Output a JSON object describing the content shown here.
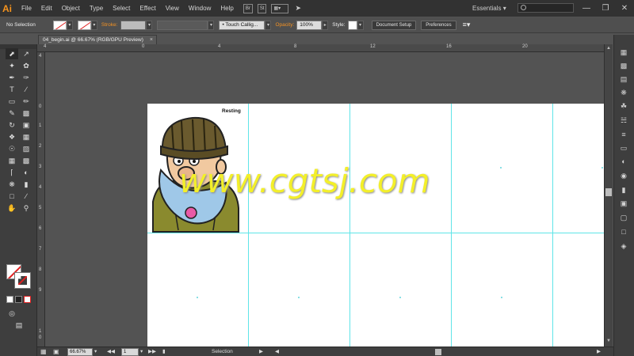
{
  "app": {
    "logo": "Ai"
  },
  "menu": [
    "File",
    "Edit",
    "Object",
    "Type",
    "Select",
    "Effect",
    "View",
    "Window",
    "Help"
  ],
  "menubar_icons": [
    "Br",
    "St"
  ],
  "workspace": {
    "label": "Essentials"
  },
  "window_controls": [
    "—",
    "❐",
    "✕"
  ],
  "control_bar": {
    "selection_status": "No Selection",
    "stroke_label": "Stroke:",
    "brush_name": "Touch Callig...",
    "opacity_label": "Opacity:",
    "opacity_value": "100%",
    "style_label": "Style:",
    "document_setup": "Document Setup",
    "preferences": "Preferences"
  },
  "document_tab": {
    "title": "04_begin.ai @ 66.67% (RGB/GPU Preview)",
    "close": "×"
  },
  "ruler_top": [
    "4",
    "0",
    "4",
    "8",
    "12",
    "16",
    "20"
  ],
  "ruler_left": [
    "4",
    "0",
    "1",
    "2",
    "3",
    "4",
    "5",
    "6",
    "7",
    "8",
    "9",
    "1",
    "0"
  ],
  "artboard": {
    "label": "Resting"
  },
  "watermark": "www.cgtsj.com",
  "status_bar": {
    "zoom": "66.67%",
    "artboard_number": "1",
    "tool_status": "Selection"
  },
  "colors": {
    "accent_orange": "#f7941d",
    "guide_cyan": "#5fe4e8",
    "watermark_yellow": "#f3ef2a"
  }
}
